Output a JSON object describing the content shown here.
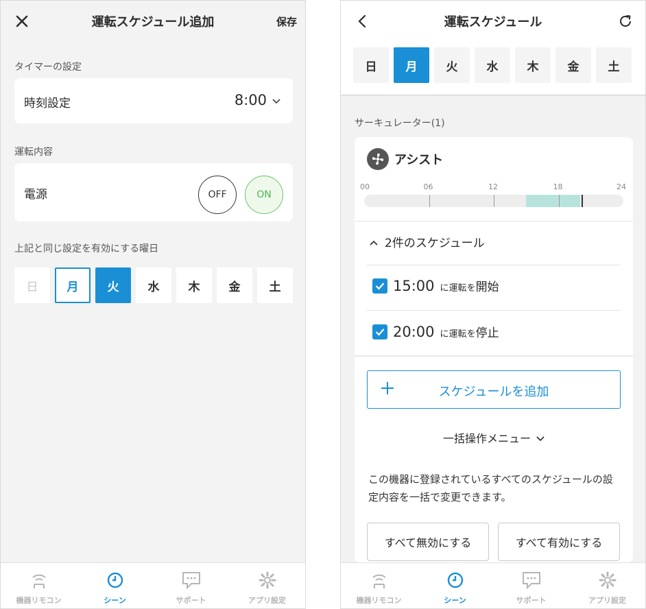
{
  "colors": {
    "accent": "#1a8fd6",
    "on_green": "#4fb24d",
    "timeline_segment": "#b8e3dc"
  },
  "left": {
    "header": {
      "title": "運転スケジュール追加",
      "close_icon": "close-icon",
      "save_label": "保存"
    },
    "timer_section_label": "タイマーの設定",
    "time_setting": {
      "label": "時刻設定",
      "value": "8:00"
    },
    "operation_section_label": "運転内容",
    "power": {
      "label": "電源",
      "off_label": "OFF",
      "on_label": "ON",
      "selected": "ON"
    },
    "repeat_section_label": "上記と同じ設定を有効にする曜日",
    "days": [
      {
        "label": "日",
        "state": "disabled"
      },
      {
        "label": "月",
        "state": "outlined"
      },
      {
        "label": "火",
        "state": "selected"
      },
      {
        "label": "水",
        "state": "normal"
      },
      {
        "label": "木",
        "state": "normal"
      },
      {
        "label": "金",
        "state": "normal"
      },
      {
        "label": "土",
        "state": "normal"
      }
    ]
  },
  "right": {
    "header": {
      "title": "運転スケジュール",
      "back_icon": "chevron-left-icon",
      "refresh_icon": "refresh-icon"
    },
    "days": [
      {
        "label": "日",
        "state": "normal"
      },
      {
        "label": "月",
        "state": "selected"
      },
      {
        "label": "火",
        "state": "normal"
      },
      {
        "label": "水",
        "state": "normal"
      },
      {
        "label": "木",
        "state": "normal"
      },
      {
        "label": "金",
        "state": "normal"
      },
      {
        "label": "土",
        "state": "normal"
      }
    ],
    "device_group_label": "サーキュレーター(1)",
    "device": {
      "name": "アシスト",
      "icon": "fan-icon",
      "timeline": {
        "tick_labels": [
          "00",
          "06",
          "12",
          "18",
          "24"
        ],
        "active_segment_hours": [
          15,
          20
        ],
        "current_hour": 20.1
      },
      "schedule_toggle": {
        "label": "2件のスケジュール",
        "expanded": true
      },
      "schedules": [
        {
          "checked": true,
          "time": "15:00",
          "connector": "に",
          "mode": "運転",
          "particle": "を",
          "action": "開始"
        },
        {
          "checked": true,
          "time": "20:00",
          "connector": "に",
          "mode": "運転",
          "particle": "を",
          "action": "停止"
        }
      ],
      "add_button_label": "スケジュールを追加",
      "bulk_menu_label": "一括操作メニュー",
      "bulk_description": "この機器に登録されているすべてのスケジュールの設定内容を一括で変更できます。",
      "disable_all_label": "すべて無効にする",
      "enable_all_label": "すべて有効にする"
    }
  },
  "bottom_nav": [
    {
      "label": "機器リモコン",
      "icon": "remote-icon",
      "active": false
    },
    {
      "label": "シーン",
      "icon": "clock-icon",
      "active": true
    },
    {
      "label": "サポート",
      "icon": "chat-icon",
      "active": false
    },
    {
      "label": "アプリ設定",
      "icon": "gear-icon",
      "active": false
    }
  ]
}
